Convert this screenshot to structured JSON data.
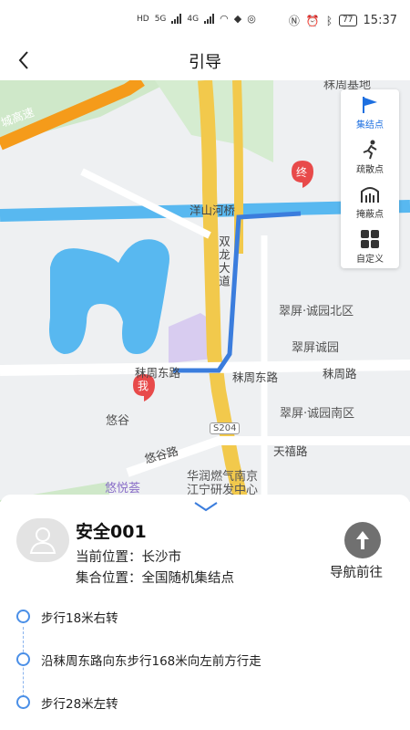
{
  "status_bar": {
    "left": [
      "HD",
      "5G",
      "4G"
    ],
    "battery": "77",
    "time": "15:37"
  },
  "header": {
    "title": "引导"
  },
  "map": {
    "labels": {
      "expressway": "城高速",
      "top_right_area": "秣周基地",
      "bridge": "洋山河桥",
      "avenue": "双龙大道",
      "community_north": "翠屏·诚园北区",
      "community": "翠屏诚园",
      "road_west": "秣周东路",
      "road_mid": "秣周东路",
      "road_east": "秣周路",
      "community_south": "翠屏·诚园南区",
      "youngu": "悠谷",
      "road_number": "S204",
      "tianxi_road": "天禧路",
      "yougu_road": "悠谷路",
      "youyue": "悠悦荟",
      "gas_line1": "华润燃气南京",
      "gas_line2": "江宁研发中心"
    },
    "markers": {
      "end": "终",
      "me": "我"
    },
    "tools": [
      {
        "label": "集结点",
        "icon": "flag-icon",
        "active": true
      },
      {
        "label": "疏散点",
        "icon": "running-person-icon",
        "active": false
      },
      {
        "label": "掩蔽点",
        "icon": "shelter-icon",
        "active": false
      },
      {
        "label": "自定义",
        "icon": "grid-icon",
        "active": false
      }
    ]
  },
  "sheet": {
    "name": "安全001",
    "current_label": "当前位置：",
    "current_value": "长沙市",
    "assembly_label": "集合位置：",
    "assembly_value": "全国随机集结点",
    "navigate_label": "导航前往",
    "steps": [
      "步行18米右转",
      "沿秣周东路向东步行168米向左前方行走",
      "步行28米左转"
    ]
  },
  "colors": {
    "accent": "#1d6fe0",
    "route": "#3b7ddd",
    "water": "#58b8f0",
    "expressway": "#f59b1a",
    "avenue": "#f2c94c"
  }
}
